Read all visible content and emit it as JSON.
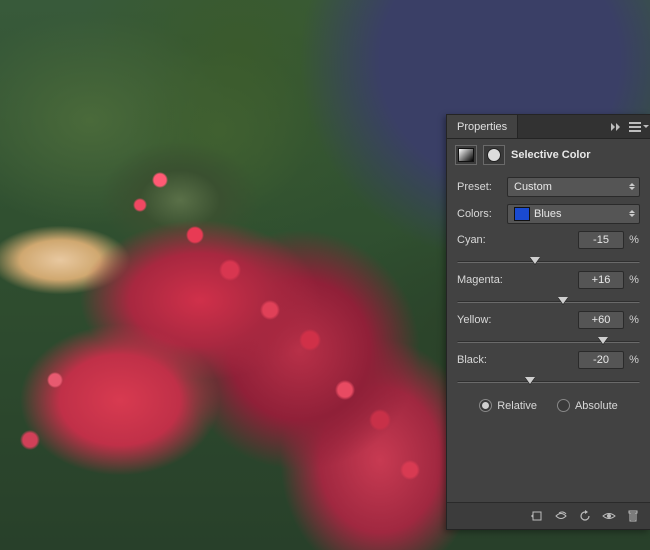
{
  "panel": {
    "tab_label": "Properties",
    "title": "Selective Color"
  },
  "preset": {
    "label": "Preset:",
    "value": "Custom"
  },
  "colors": {
    "label": "Colors:",
    "value": "Blues",
    "swatch": "#1a4ad0"
  },
  "sliders": {
    "cyan": {
      "label": "Cyan:",
      "value": "-15",
      "pos": 42.5
    },
    "magenta": {
      "label": "Magenta:",
      "value": "+16",
      "pos": 58.0
    },
    "yellow": {
      "label": "Yellow:",
      "value": "+60",
      "pos": 80.0
    },
    "black": {
      "label": "Black:",
      "value": "-20",
      "pos": 40.0
    }
  },
  "mode": {
    "relative_label": "Relative",
    "absolute_label": "Absolute",
    "selected": "relative"
  },
  "percent_sign": "%"
}
